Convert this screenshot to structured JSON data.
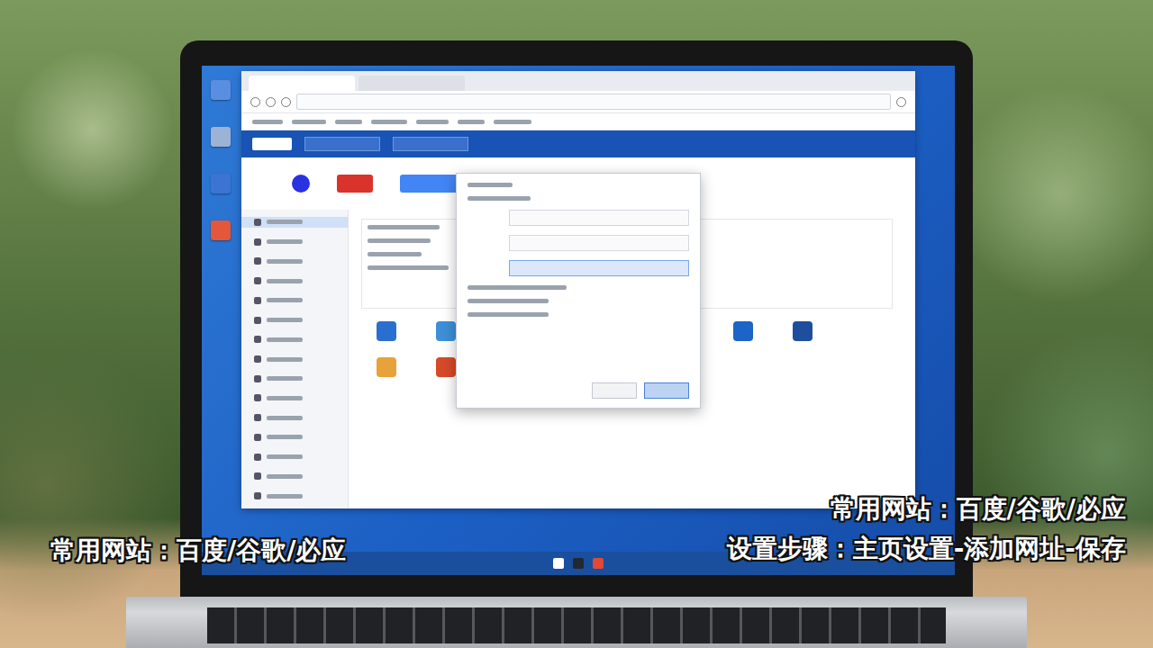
{
  "captions": {
    "right": [
      "常用网站：百度/谷歌/必应",
      "设置步骤：主页设置-添加网址-保存"
    ],
    "left": "常用网站：百度/谷歌/必应"
  }
}
